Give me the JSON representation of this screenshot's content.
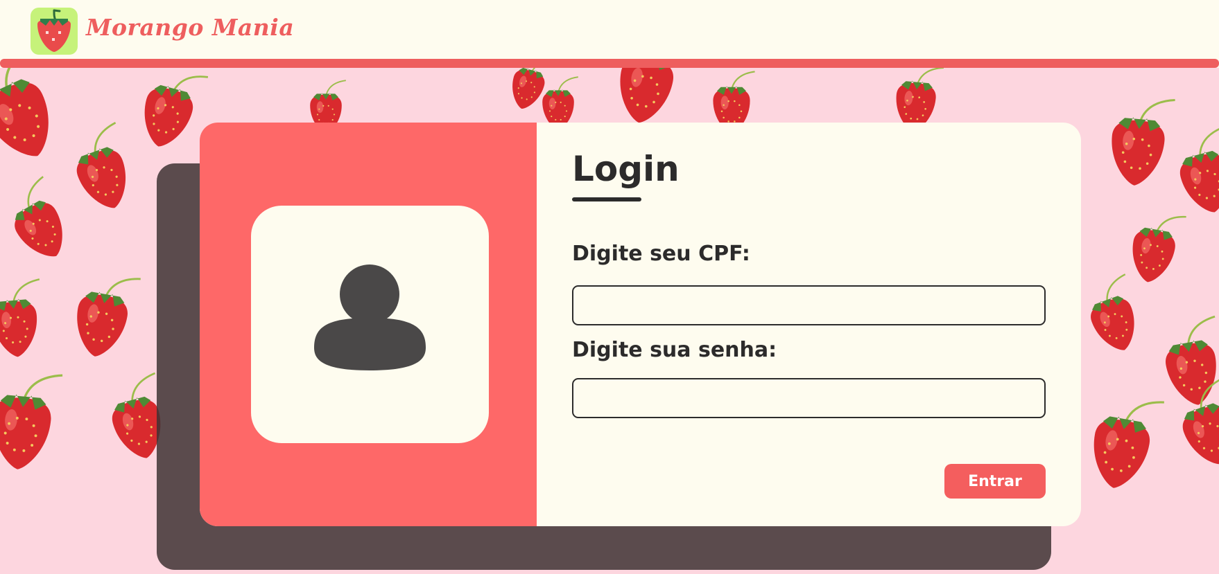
{
  "header": {
    "brand_name": "Morango Mania",
    "logo_icon": "strawberry-icon",
    "accent_color": "#ee5e5e",
    "logo_bg_color": "#c6f27a"
  },
  "background": {
    "pattern": "strawberry-pattern",
    "color": "#fdd6df"
  },
  "login": {
    "title": "Login",
    "avatar_icon": "user-icon",
    "cpf_label": "Digite seu CPF:",
    "cpf_value": "",
    "password_label": "Digite sua senha:",
    "password_value": "",
    "submit_label": "Entrar",
    "panel_color": "#fe6868",
    "card_color": "#fefcef"
  }
}
